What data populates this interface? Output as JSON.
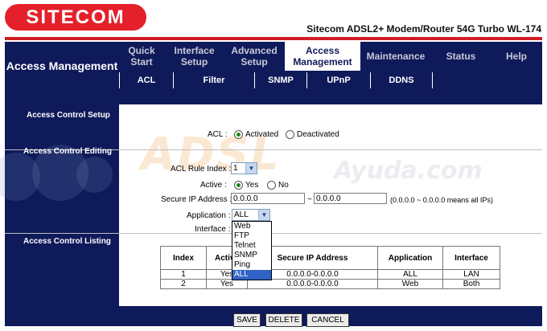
{
  "header": {
    "logo": "SITECOM",
    "model": "Sitecom ADSL2+ Modem/Router 54G Turbo WL-174"
  },
  "nav": {
    "section_title": "Access Management",
    "tabs": [
      {
        "label": "Quick Start"
      },
      {
        "label": "Interface Setup"
      },
      {
        "label": "Advanced Setup"
      },
      {
        "label": "Access Management"
      },
      {
        "label": "Maintenance"
      },
      {
        "label": "Status"
      },
      {
        "label": "Help"
      }
    ],
    "subtabs": [
      "ACL",
      "Filter",
      "SNMP",
      "UPnP",
      "DDNS"
    ]
  },
  "sections": {
    "setup": "Access Control Setup",
    "editing": "Access Control Editing",
    "listing": "Access Control Listing"
  },
  "form": {
    "acl_label": "ACL :",
    "acl_options": [
      "Activated",
      "Deactivated"
    ],
    "acl_selected": "Activated",
    "rule_index_label": "ACL Rule Index :",
    "rule_index_value": "1",
    "active_label": "Active :",
    "active_options": [
      "Yes",
      "No"
    ],
    "active_selected": "Yes",
    "secure_ip_label": "Secure IP Address :",
    "ip_start": "0.0.0.0",
    "ip_sep": "~",
    "ip_end": "0.0.0.0",
    "ip_hint": "(0.0.0.0 ~ 0.0.0.0 means all IPs)",
    "application_label": "Application :",
    "application_value": "ALL",
    "application_options": [
      "Web",
      "FTP",
      "Telnet",
      "SNMP",
      "Ping",
      "ALL"
    ],
    "interface_label": "Interface :"
  },
  "table": {
    "headers": [
      "Index",
      "Active",
      "Secure IP Address",
      "Application",
      "Interface"
    ],
    "rows": [
      [
        "1",
        "Yes",
        "0.0.0.0-0.0.0.0",
        "ALL",
        "LAN"
      ],
      [
        "2",
        "Yes",
        "0.0.0.0-0.0.0.0",
        "Web",
        "Both"
      ]
    ]
  },
  "buttons": {
    "save": "SAVE",
    "delete": "DELETE",
    "cancel": "CANCEL"
  },
  "colors": {
    "navy": "#0f1a5a",
    "brand_red": "#e4202a"
  }
}
